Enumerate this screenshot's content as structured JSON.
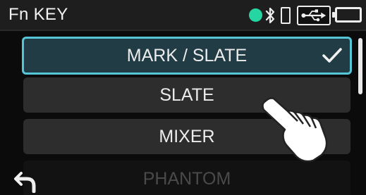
{
  "header": {
    "title": "Fn KEY",
    "status_dot_color": "#26d6a2",
    "icons": [
      "bluetooth-icon",
      "phone-icon",
      "usb-icon",
      "battery-icon"
    ]
  },
  "menu": {
    "items": [
      {
        "label": "MARK / SLATE",
        "selected": true
      },
      {
        "label": "SLATE",
        "selected": false
      },
      {
        "label": "MIXER",
        "selected": false
      },
      {
        "label": "PHANTOM",
        "selected": false
      }
    ],
    "selection_color": "#56c5d8"
  },
  "back_icon": "back-arrow-icon",
  "gesture_icon": "tap-hand-icon"
}
